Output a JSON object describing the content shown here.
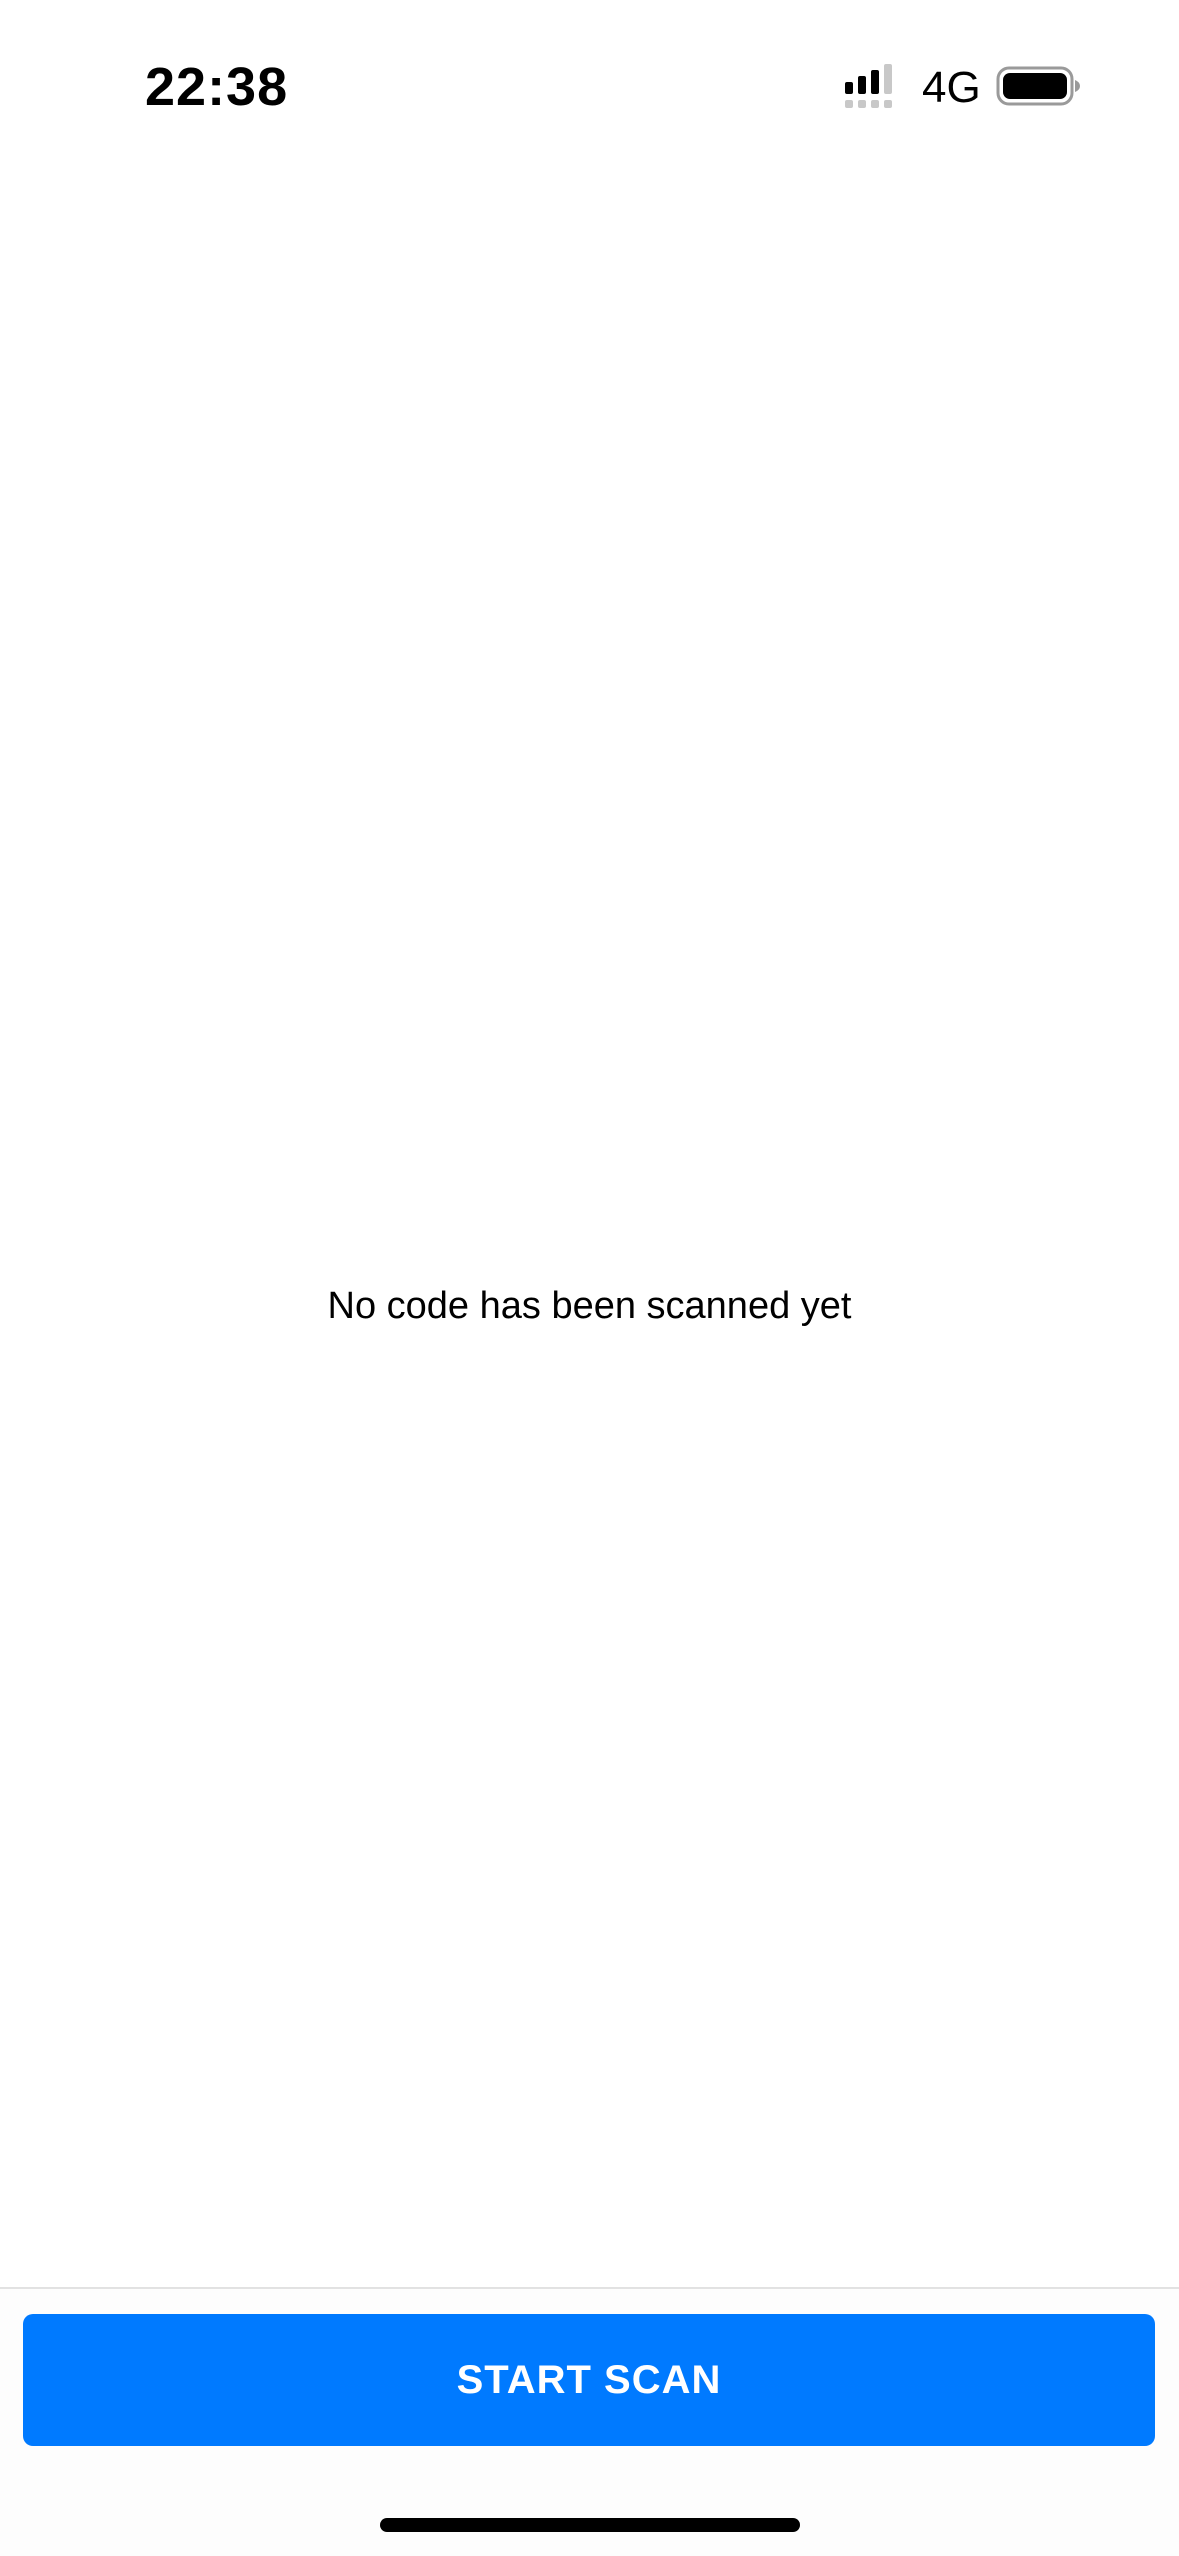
{
  "status_bar": {
    "time": "22:38",
    "network": "4G",
    "signal_icon": "cellular-signal-icon",
    "battery_icon": "battery-icon"
  },
  "main": {
    "empty_message": "No code has been scanned yet"
  },
  "bottom_bar": {
    "scan_button_label": "START SCAN"
  },
  "colors": {
    "accent": "#007aff",
    "background": "#ffffff",
    "text": "#000000"
  }
}
